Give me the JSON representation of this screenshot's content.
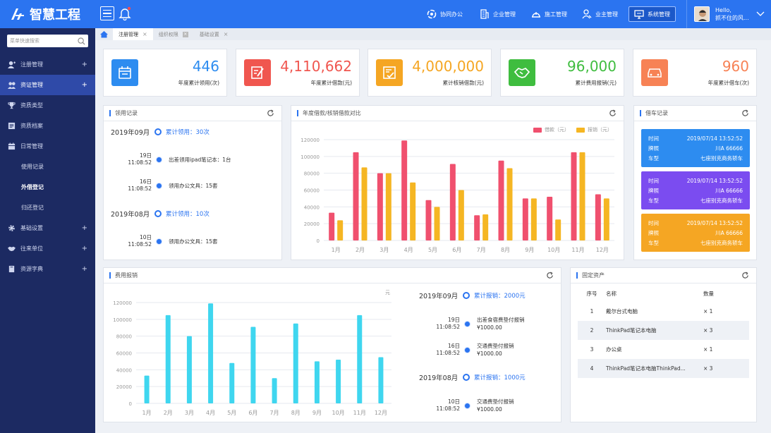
{
  "brand": {
    "name": "智慧工程"
  },
  "sidebar": {
    "search_placeholder": "菜单快速搜索",
    "items": [
      {
        "label": "注册管理",
        "icon": "user-plus-icon",
        "expandable": true
      },
      {
        "label": "资证管理",
        "icon": "users-icon",
        "expandable": true,
        "active": true
      },
      {
        "label": "资质类型",
        "icon": "trophy-icon"
      },
      {
        "label": "资质档案",
        "icon": "archive-icon"
      },
      {
        "label": "日常管理",
        "icon": "calendar-icon"
      },
      {
        "label": "使用记录",
        "sub": true
      },
      {
        "label": "外借登记",
        "sub": true,
        "current": true
      },
      {
        "label": "归还登记",
        "sub": true
      },
      {
        "label": "基础设置",
        "icon": "gear-icon",
        "expandable": true
      },
      {
        "label": "往来单位",
        "icon": "handshake-icon",
        "expandable": true
      },
      {
        "label": "资源字典",
        "icon": "book-icon",
        "expandable": true
      }
    ]
  },
  "topnav": {
    "items": [
      {
        "label": "协同办公",
        "icon": "cooperation-icon"
      },
      {
        "label": "企业管理",
        "icon": "building-icon"
      },
      {
        "label": "施工管理",
        "icon": "helmet-icon"
      },
      {
        "label": "业主管理",
        "icon": "owner-icon"
      },
      {
        "label": "系统管理",
        "icon": "monitor-icon",
        "selected": true
      }
    ],
    "user_greeting": "Hello,",
    "user_name": "抓不住的风..."
  },
  "tabs": [
    {
      "label": "注册管理",
      "active": true
    },
    {
      "label": "组织权限"
    },
    {
      "label": "基础设置"
    }
  ],
  "stats": [
    {
      "value": "446",
      "label": "年度累计领用(次)",
      "color": "#2d8cf0",
      "icon": "calendar-check-icon"
    },
    {
      "value": "4,110,662",
      "label": "年度累计借款(元)",
      "color": "#f0564f",
      "icon": "edit-doc-icon"
    },
    {
      "value": "4,000,000",
      "label": "累计核销借款(元)",
      "color": "#f5a623",
      "icon": "check-doc-icon"
    },
    {
      "value": "96,000",
      "label": "累计费用报销(元)",
      "color": "#3fbd3f",
      "icon": "handshake-icon"
    },
    {
      "value": "960",
      "label": "年度累计借车(次)",
      "color": "#f78255",
      "icon": "car-icon"
    }
  ],
  "usage": {
    "title": "领用记录",
    "groups": [
      {
        "month": "2019年09月",
        "summary": "累计领用：30次",
        "rows": [
          {
            "day": "19日",
            "time": "11:08:52",
            "desc": "出差领用ipad笔记本：1台"
          },
          {
            "day": "16日",
            "time": "11:08:52",
            "desc": "领用办公文具：15套"
          }
        ]
      },
      {
        "month": "2019年08月",
        "summary": "累计领用：10次",
        "rows": [
          {
            "day": "10日",
            "time": "11:08:52",
            "desc": "领用办公文具：15套"
          }
        ]
      }
    ]
  },
  "borrow_chart": {
    "title": "年度借款/核销借款对比",
    "chart_data": {
      "type": "bar",
      "categories": [
        "1月",
        "2月",
        "3月",
        "4月",
        "5月",
        "6月",
        "7月",
        "8月",
        "9月",
        "10月",
        "11月",
        "12月"
      ],
      "series": [
        {
          "name": "借款（元）",
          "color": "#f0506e",
          "values": [
            33000,
            105000,
            80000,
            119000,
            48000,
            91000,
            30000,
            95000,
            50000,
            52000,
            105000,
            55000
          ]
        },
        {
          "name": "报销（元）",
          "color": "#f5b623",
          "values": [
            24000,
            87000,
            80000,
            69000,
            40000,
            60000,
            31000,
            86000,
            50000,
            25000,
            105000,
            50000
          ]
        }
      ],
      "ylim": [
        0,
        120000
      ],
      "yticks": [
        "0",
        "20000",
        "40000",
        "60000",
        "80000",
        "100000",
        "120000"
      ]
    }
  },
  "car": {
    "title": "借车记录",
    "records": [
      {
        "time_label": "时间",
        "time": "2019/07/14  13:52:52",
        "plate_label": "牌照",
        "plate": "川A 66666",
        "model_label": "车型",
        "model": "七座别克商务轿车",
        "color": "#2d8cf0"
      },
      {
        "time_label": "时间",
        "time": "2019/07/14  13:52:52",
        "plate_label": "牌照",
        "plate": "川A 66666",
        "model_label": "车型",
        "model": "七座别克商务轿车",
        "color": "#7b4cf0"
      },
      {
        "time_label": "时间",
        "time": "2019/07/14  13:52:52",
        "plate_label": "牌照",
        "plate": "川A 66666",
        "model_label": "车型",
        "model": "七座别克商务轿车",
        "color": "#f5a623"
      }
    ]
  },
  "expense": {
    "title": "费用报销",
    "unit": "元",
    "chart_data": {
      "type": "bar",
      "categories": [
        "1月",
        "2月",
        "3月",
        "4月",
        "5月",
        "6月",
        "7月",
        "8月",
        "9月",
        "10月",
        "11月",
        "12月"
      ],
      "values": [
        33000,
        105000,
        80000,
        119000,
        48000,
        91000,
        30000,
        95000,
        50000,
        52000,
        105000,
        55000
      ],
      "color": "#3fd6ef",
      "ylim": [
        0,
        120000
      ],
      "yticks": [
        "0",
        "20000",
        "40000",
        "60000",
        "80000",
        "100000",
        "120000"
      ]
    },
    "groups": [
      {
        "month": "2019年09月",
        "summary": "累计报销：2000元",
        "rows": [
          {
            "day": "19日",
            "time": "11:08:52",
            "desc": "出差食宿费垫付报销",
            "amount": "¥1000.00"
          },
          {
            "day": "16日",
            "time": "11:08:52",
            "desc": "交通费垫付报销",
            "amount": "¥1000.00"
          }
        ]
      },
      {
        "month": "2019年08月",
        "summary": "累计报销：1000元",
        "rows": [
          {
            "day": "10日",
            "time": "11:08:52",
            "desc": "交通费垫付报销",
            "amount": "¥1000.00"
          }
        ]
      }
    ]
  },
  "assets": {
    "title": "固定资产",
    "headers": [
      "序号",
      "名称",
      "数量"
    ],
    "rows": [
      [
        "1",
        "戴尔台式电脑",
        "× 1"
      ],
      [
        "2",
        "ThinkPad笔记本电脑",
        "× 3"
      ],
      [
        "3",
        "办公桌",
        "× 1"
      ],
      [
        "4",
        "ThinkPad笔记本电脑ThinkPad...",
        "× 3"
      ]
    ]
  }
}
